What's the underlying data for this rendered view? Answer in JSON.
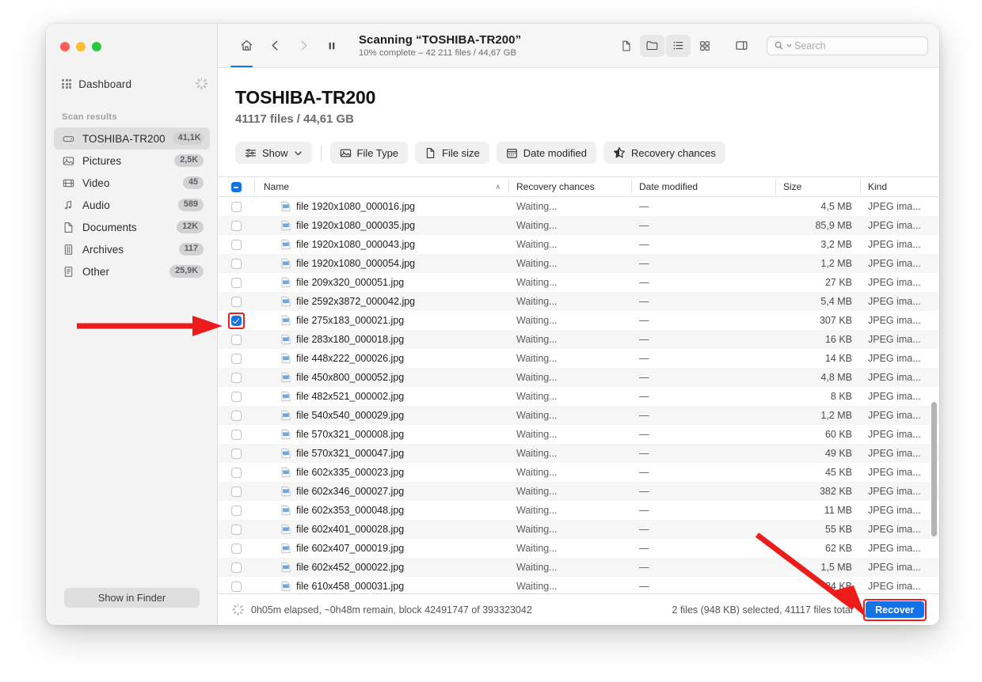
{
  "window": {
    "traffic_lights": [
      "close",
      "minimize",
      "zoom"
    ]
  },
  "sidebar": {
    "dashboard_label": "Dashboard",
    "section_title": "Scan results",
    "items": [
      {
        "label": "TOSHIBA-TR200",
        "badge": "41,1K",
        "icon": "drive-icon",
        "active": true
      },
      {
        "label": "Pictures",
        "badge": "2,5K",
        "icon": "picture-icon",
        "active": false
      },
      {
        "label": "Video",
        "badge": "45",
        "icon": "video-icon",
        "active": false
      },
      {
        "label": "Audio",
        "badge": "589",
        "icon": "audio-icon",
        "active": false
      },
      {
        "label": "Documents",
        "badge": "12K",
        "icon": "document-icon",
        "active": false
      },
      {
        "label": "Archives",
        "badge": "117",
        "icon": "archive-icon",
        "active": false
      },
      {
        "label": "Other",
        "badge": "25,9K",
        "icon": "other-icon",
        "active": false
      }
    ],
    "show_in_finder_label": "Show in Finder"
  },
  "toolbar": {
    "home_icon": "home-icon",
    "back_icon": "chevron-left-icon",
    "forward_icon": "chevron-right-icon",
    "pause_icon": "pause-icon",
    "scan_title": "Scanning “TOSHIBA-TR200”",
    "scan_subtitle": "10% complete – 42 211 files / 44,67 GB",
    "view_buttons": [
      "file-view-icon",
      "folder-view-icon",
      "list-view-icon",
      "grid-view-icon",
      "preview-pane-icon"
    ],
    "search": {
      "placeholder": "Search",
      "value": ""
    }
  },
  "page": {
    "title": "TOSHIBA-TR200",
    "subtitle": "41117 files / 44,61 GB"
  },
  "filters": {
    "show_label": "Show",
    "chips": [
      {
        "label": "File Type",
        "icon": "picture-icon"
      },
      {
        "label": "File size",
        "icon": "document-icon"
      },
      {
        "label": "Date modified",
        "icon": "calendar-icon"
      },
      {
        "label": "Recovery chances",
        "icon": "star-icon"
      }
    ]
  },
  "table": {
    "header_checkbox_state": "indeterminate",
    "columns": [
      "Name",
      "Recovery chances",
      "Date modified",
      "Size",
      "Kind"
    ],
    "sort_indicator": "∧",
    "rows": [
      {
        "name": "file 1920x1080_000016.jpg",
        "recovery": "Waiting...",
        "date": "—",
        "size": "4,5 MB",
        "kind": "JPEG ima...",
        "checked": false
      },
      {
        "name": "file 1920x1080_000035.jpg",
        "recovery": "Waiting...",
        "date": "—",
        "size": "85,9 MB",
        "kind": "JPEG ima...",
        "checked": false
      },
      {
        "name": "file 1920x1080_000043.jpg",
        "recovery": "Waiting...",
        "date": "—",
        "size": "3,2 MB",
        "kind": "JPEG ima...",
        "checked": false
      },
      {
        "name": "file 1920x1080_000054.jpg",
        "recovery": "Waiting...",
        "date": "—",
        "size": "1,2 MB",
        "kind": "JPEG ima...",
        "checked": false
      },
      {
        "name": "file 209x320_000051.jpg",
        "recovery": "Waiting...",
        "date": "—",
        "size": "27 KB",
        "kind": "JPEG ima...",
        "checked": false
      },
      {
        "name": "file 2592x3872_000042.jpg",
        "recovery": "Waiting...",
        "date": "—",
        "size": "5,4 MB",
        "kind": "JPEG ima...",
        "checked": false
      },
      {
        "name": "file 275x183_000021.jpg",
        "recovery": "Waiting...",
        "date": "—",
        "size": "307 KB",
        "kind": "JPEG ima...",
        "checked": true
      },
      {
        "name": "file 283x180_000018.jpg",
        "recovery": "Waiting...",
        "date": "—",
        "size": "16 KB",
        "kind": "JPEG ima...",
        "checked": false
      },
      {
        "name": "file 448x222_000026.jpg",
        "recovery": "Waiting...",
        "date": "—",
        "size": "14 KB",
        "kind": "JPEG ima...",
        "checked": false
      },
      {
        "name": "file 450x800_000052.jpg",
        "recovery": "Waiting...",
        "date": "—",
        "size": "4,8 MB",
        "kind": "JPEG ima...",
        "checked": false
      },
      {
        "name": "file 482x521_000002.jpg",
        "recovery": "Waiting...",
        "date": "—",
        "size": "8 KB",
        "kind": "JPEG ima...",
        "checked": false
      },
      {
        "name": "file 540x540_000029.jpg",
        "recovery": "Waiting...",
        "date": "—",
        "size": "1,2 MB",
        "kind": "JPEG ima...",
        "checked": false
      },
      {
        "name": "file 570x321_000008.jpg",
        "recovery": "Waiting...",
        "date": "—",
        "size": "60 KB",
        "kind": "JPEG ima...",
        "checked": false
      },
      {
        "name": "file 570x321_000047.jpg",
        "recovery": "Waiting...",
        "date": "—",
        "size": "49 KB",
        "kind": "JPEG ima...",
        "checked": false
      },
      {
        "name": "file 602x335_000023.jpg",
        "recovery": "Waiting...",
        "date": "—",
        "size": "45 KB",
        "kind": "JPEG ima...",
        "checked": false
      },
      {
        "name": "file 602x346_000027.jpg",
        "recovery": "Waiting...",
        "date": "—",
        "size": "382 KB",
        "kind": "JPEG ima...",
        "checked": false
      },
      {
        "name": "file 602x353_000048.jpg",
        "recovery": "Waiting...",
        "date": "—",
        "size": "11 MB",
        "kind": "JPEG ima...",
        "checked": false
      },
      {
        "name": "file 602x401_000028.jpg",
        "recovery": "Waiting...",
        "date": "—",
        "size": "55 KB",
        "kind": "JPEG ima...",
        "checked": false
      },
      {
        "name": "file 602x407_000019.jpg",
        "recovery": "Waiting...",
        "date": "—",
        "size": "62 KB",
        "kind": "JPEG ima...",
        "checked": false
      },
      {
        "name": "file 602x452_000022.jpg",
        "recovery": "Waiting...",
        "date": "—",
        "size": "1,5 MB",
        "kind": "JPEG ima...",
        "checked": false
      },
      {
        "name": "file 610x458_000031.jpg",
        "recovery": "Waiting...",
        "date": "—",
        "size": "24 KB",
        "kind": "JPEG ima...",
        "checked": false
      }
    ]
  },
  "statusbar": {
    "progress_text": "0h05m elapsed, ~0h48m remain, block 42491747 of 393323042",
    "selection_text": "2 files (948 KB) selected, 41117 files total",
    "recover_label": "Recover"
  },
  "annotations": {
    "arrow_color": "#ee1b1b",
    "highlight_color": "#f01b1b",
    "targets": [
      "row-checkbox-file-275x183_000021",
      "recover-button"
    ]
  },
  "colors": {
    "accent": "#1273e6",
    "sidebar_bg": "#f3f3f3",
    "toolbar_bg": "#f6f6f6",
    "row_alt_bg": "#f6f6f6",
    "badge_bg": "#d2d2d4"
  }
}
